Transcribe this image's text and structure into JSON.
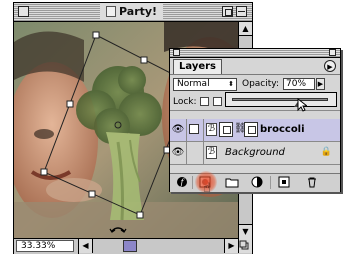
{
  "document": {
    "title": "Party!",
    "zoom": "33.33%"
  },
  "layers_panel": {
    "tab_label": "Layers",
    "blend_mode": "Normal",
    "opacity_label": "Opacity:",
    "opacity_value": "70%",
    "lock_label": "Lock:",
    "opacity_slider_value": 0.7,
    "layers": [
      {
        "name": "broccoli",
        "active": true
      },
      {
        "name": "Background",
        "active": false
      }
    ],
    "icons": [
      "eye-icon",
      "brush-icon",
      "link-icon",
      "lock-icon",
      "layer-style-icon",
      "add-mask-icon",
      "new-set-icon",
      "adjustment-layer-icon",
      "new-layer-icon",
      "trash-icon",
      "palette-menu-icon"
    ]
  },
  "colors": {
    "active_layer": "#c8c6e6",
    "scroll_thumb": "#8c86c8",
    "mask_highlight": "#e64628"
  }
}
